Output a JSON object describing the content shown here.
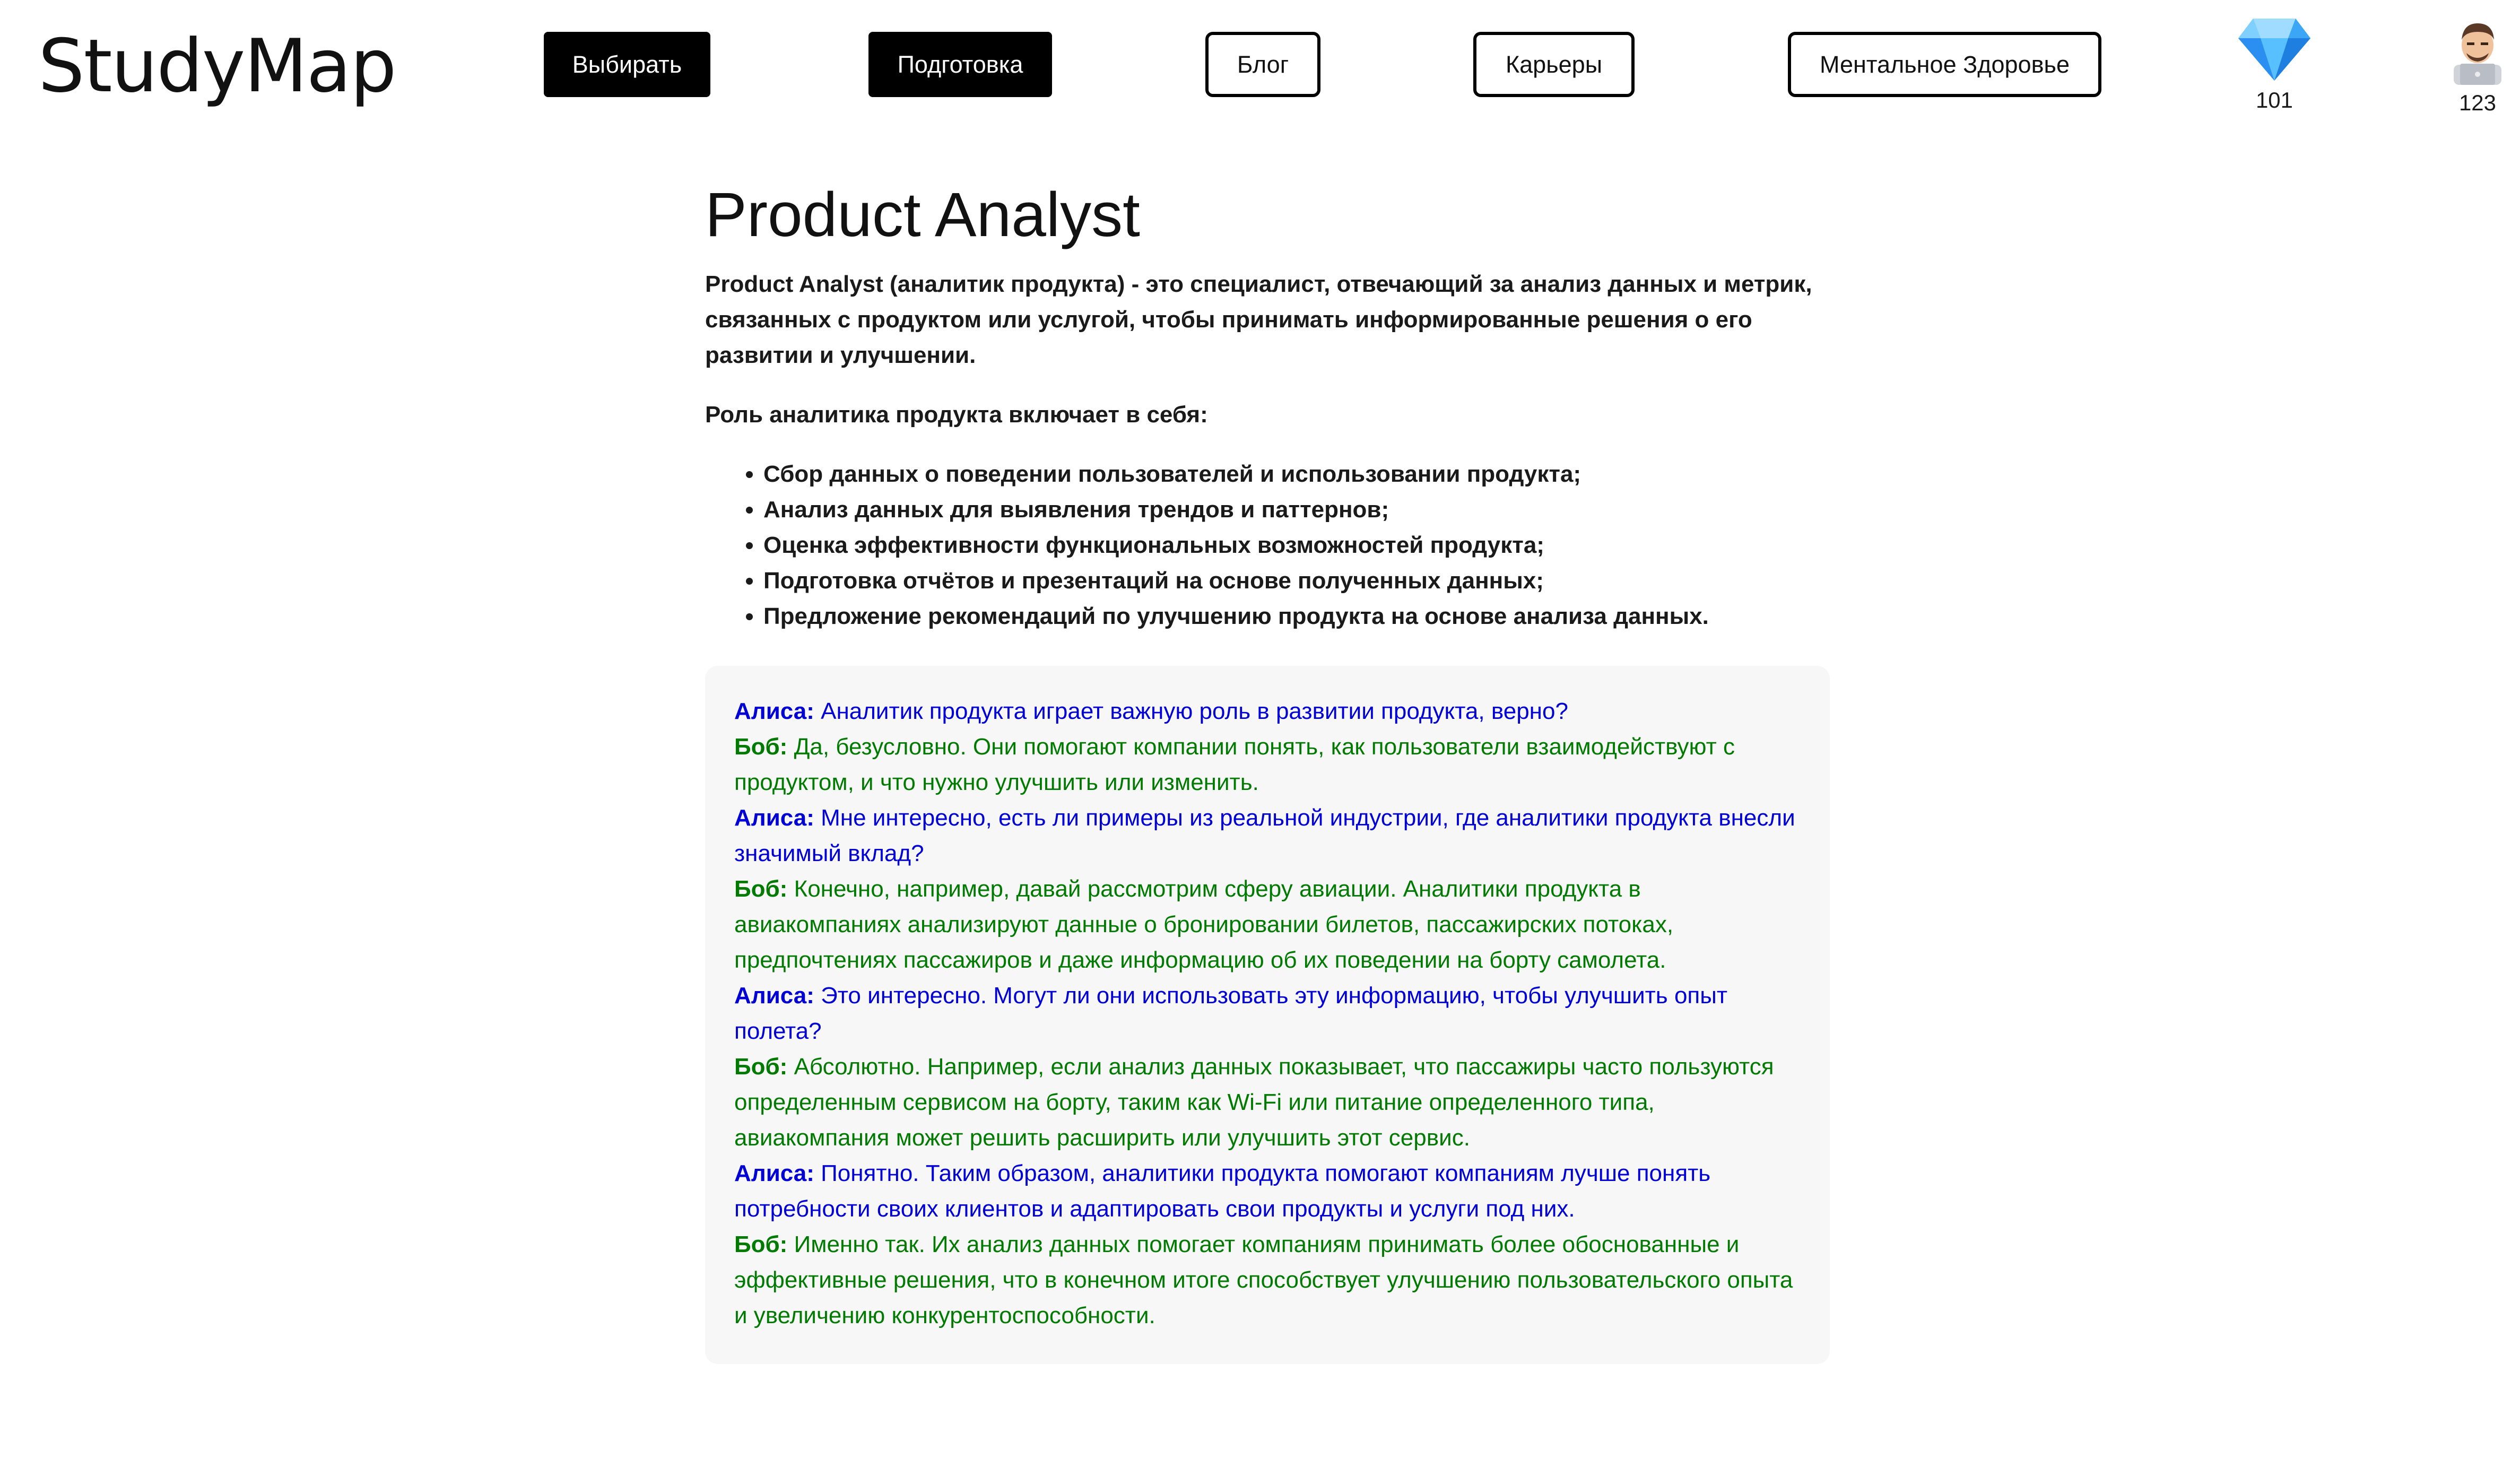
{
  "header": {
    "logo": "StudyMap",
    "nav": [
      {
        "label": "Выбирать",
        "style": "dark"
      },
      {
        "label": "Подготовка",
        "style": "dark"
      },
      {
        "label": "Блог",
        "style": "light"
      },
      {
        "label": "Карьеры",
        "style": "light"
      },
      {
        "label": "Ментальное Здоровье",
        "style": "light"
      }
    ],
    "gems": {
      "icon": "gem-icon",
      "count": "101"
    },
    "profile": {
      "icon": "avatar-icon",
      "count": "123"
    }
  },
  "article": {
    "title": "Product Analyst",
    "intro": "Product Analyst (аналитик продукта) - это специалист, отвечающий за анализ данных и метрик, связанных с продуктом или услугой, чтобы принимать информированные решения о его развитии и улучшении.",
    "role_heading": "Роль аналитика продукта включает в себя:",
    "points": [
      "Сбор данных о поведении пользователей и использовании продукта;",
      "Анализ данных для выявления трендов и паттернов;",
      "Оценка эффективности функциональных возможностей продукта;",
      "Подготовка отчётов и презентаций на основе полученных данных;",
      "Предложение рекомендаций по улучшению продукта на основе анализа данных."
    ]
  },
  "dialog": [
    {
      "speaker": "Алиса:",
      "who": "alice",
      "text": "Аналитик продукта играет важную роль в развитии продукта, верно?"
    },
    {
      "speaker": "Боб:",
      "who": "bob",
      "text": "Да, безусловно. Они помогают компании понять, как пользователи взаимодействуют с продуктом, и что нужно улучшить или изменить."
    },
    {
      "speaker": "Алиса:",
      "who": "alice",
      "text": "Мне интересно, есть ли примеры из реальной индустрии, где аналитики продукта внесли значимый вклад?"
    },
    {
      "speaker": "Боб:",
      "who": "bob",
      "text": "Конечно, например, давай рассмотрим сферу авиации. Аналитики продукта в авиакомпаниях анализируют данные о бронировании билетов, пассажирских потоках, предпочтениях пассажиров и даже информацию об их поведении на борту самолета."
    },
    {
      "speaker": "Алиса:",
      "who": "alice",
      "text": "Это интересно. Могут ли они использовать эту информацию, чтобы улучшить опыт полета?"
    },
    {
      "speaker": "Боб:",
      "who": "bob",
      "text": "Абсолютно. Например, если анализ данных показывает, что пассажиры часто пользуются определенным сервисом на борту, таким как Wi-Fi или питание определенного типа, авиакомпания может решить расширить или улучшить этот сервис."
    },
    {
      "speaker": "Алиса:",
      "who": "alice",
      "text": "Понятно. Таким образом, аналитики продукта помогают компаниям лучше понять потребности своих клиентов и адаптировать свои продукты и услуги под них."
    },
    {
      "speaker": "Боб:",
      "who": "bob",
      "text": "Именно так. Их анализ данных помогает компаниям принимать более обоснованные и эффективные решения, что в конечном итоге способствует улучшению пользовательского опыта и увеличению конкурентоспособности."
    }
  ],
  "colors": {
    "alice": "#0000d6",
    "bob": "#007a00",
    "dialog_bg": "#f7f7f7"
  }
}
